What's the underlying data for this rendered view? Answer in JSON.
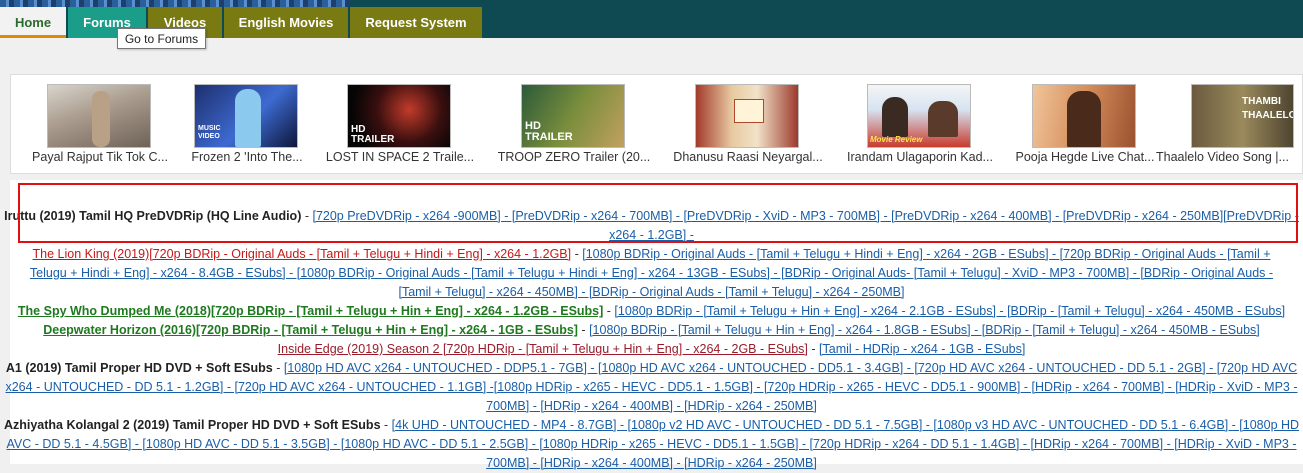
{
  "nav": {
    "tabs": [
      "Home",
      "Forums",
      "Videos",
      "English Movies",
      "Request System"
    ],
    "tooltip": "Go to Forums"
  },
  "videos": [
    {
      "caption": "Payal Rajput Tik Tok C...",
      "overlay": ""
    },
    {
      "caption": "Frozen 2 'Into The...",
      "overlay": "MUSIC VIDEO"
    },
    {
      "caption": "LOST IN SPACE 2 Traile...",
      "overlay": "HD TRAILER"
    },
    {
      "caption": "TROOP ZERO Trailer (20...",
      "overlay": "HD TRAILER"
    },
    {
      "caption": "Dhanusu Raasi Neyargal...",
      "overlay": ""
    },
    {
      "caption": "Irandam Ulagaporin Kad...",
      "overlay": "Movie Review"
    },
    {
      "caption": "Pooja Hegde Live Chat...",
      "overlay": ""
    },
    {
      "caption": "Thaalelo Video Song |...",
      "overlay": "THAMBI THAALELO"
    }
  ],
  "releases": [
    {
      "line1_title": "Iruttu (2019) Tamil HQ PreDVDRip (HQ Line Audio)",
      "line1_links": "[720p PreDVDRip - x264 -900MB] - [PreDVDRip - x264 - 700MB] - [PreDVDRip - XviD - MP3 - 700MB] - [PreDVDRip - x264 - 400MB] - [PreDVDRip - x264 - 250MB][PreDVDRip -",
      "line2": "x264 - 1.2GB] -"
    },
    {
      "line1_title": "The Lion King (2019)[720p BDRip - Original Auds - [Tamil + Telugu + Hindi + Eng] - x264 - 1.2GB]",
      "line1_links": "[1080p BDRip - Original Auds - [Tamil + Telugu + Hindi + Eng] - x264 - 2GB - ESubs] - [720p BDRip - Original Auds - [Tamil +",
      "line2": "Telugu + Hindi + Eng] - x264 - 8.4GB - ESubs] - [1080p BDRip - Original Auds - [Tamil + Telugu + Hindi + Eng] - x264 - 13GB - ESubs] - [BDRip - Original Auds- [Tamil + Telugu] - XviD - MP3 - 700MB] - [BDRip - Original Auds -",
      "line3": "[Tamil + Telugu] - x264 - 450MB] - [BDRip - Original Auds - [Tamil + Telugu] - x264 - 250MB]"
    },
    {
      "line1_title": "The Spy Who Dumped Me (2018)[720p BDRip - [Tamil + Telugu + Hin + Eng] - x264 - 1.2GB - ESubs]",
      "line1_links": "[1080p BDRip - [Tamil + Telugu + Hin + Eng] - x264 - 2.1GB - ESubs] - [BDRip - [Tamil + Telugu] - x264 - 450MB - ESubs]"
    },
    {
      "line1_title": "Deepwater Horizon (2016)[720p BDRip - [Tamil + Telugu + Hin + Eng] - x264 - 1GB - ESubs]",
      "line1_links": "[1080p BDRip - [Tamil + Telugu + Hin + Eng] - x264 - 1.8GB - ESubs] - [BDRip - [Tamil + Telugu] - x264 - 450MB - ESubs]"
    },
    {
      "line1_title": "Inside Edge (2019) Season 2 [720p HDRip - [Tamil + Telugu + Hin + Eng] - x264 - 2GB - ESubs]",
      "line1_links": "[Tamil - HDRip - x264 - 1GB - ESubs]"
    },
    {
      "line1_title": "A1 (2019) Tamil Proper HD DVD + Soft ESubs",
      "line1_links": "[1080p HD AVC x264 - UNTOUCHED - DDP5.1 - 7GB] - [1080p HD AVC x264 - UNTOUCHED - DD5.1 - 3.4GB] - [720p HD AVC x264 - UNTOUCHED - DD 5.1 - 2GB] - [720p HD AVC",
      "line2": "x264 - UNTOUCHED - DD 5.1 - 1.2GB] - [720p HD AVC x264 - UNTOUCHED - 1.1GB] -[1080p HDRip - x265 - HEVC - DD5.1 - 1.5GB] - [720p HDRip - x265 - HEVC - DD5.1 - 900MB] - [HDRip - x264 - 700MB] - [HDRip - XviD - MP3 -",
      "line3": "700MB] - [HDRip - x264 - 400MB] - [HDRip - x264 - 250MB]"
    },
    {
      "line1_title": "Azhiyatha Kolangal 2 (2019) Tamil Proper HD DVD + Soft ESubs",
      "line1_links": "[4k UHD - UNTOUCHED - MP4 - 8.7GB] - [1080p v2 HD AVC - UNTOUCHED - DD 5.1 - 7.5GB] - [1080p v3 HD AVC - UNTOUCHED - DD 5.1 - 6.4GB] - [1080p HD",
      "line2": "AVC - DD 5.1 - 4.5GB] - [1080p HD AVC - DD 5.1 - 3.5GB] - [1080p HD AVC - DD 5.1 - 2.5GB] - [1080p HDRip - x265 - HEVC - DD5.1 - 1.5GB] - [720p HDRip - x264 - DD 5.1 - 1.4GB] - [HDRip - x264 - 700MB] - [HDRip - XviD - MP3 -",
      "line3": "700MB] - [HDRip - x264 - 400MB] - [HDRip - x264 - 250MB]"
    }
  ]
}
